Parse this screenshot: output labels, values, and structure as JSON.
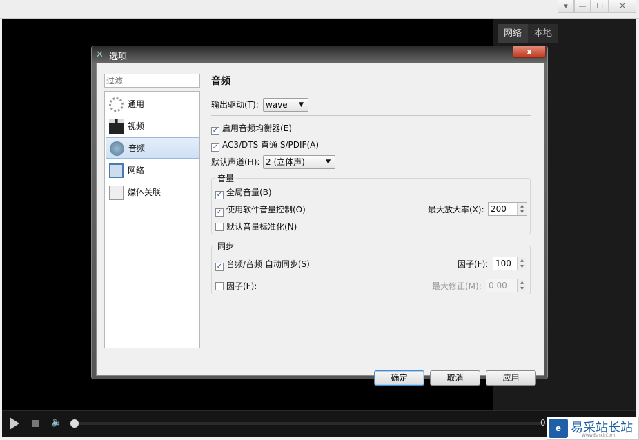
{
  "window": {
    "controls": [
      "▾",
      "—",
      "☐",
      "✕"
    ]
  },
  "right_panel": {
    "tabs": [
      "网络",
      "本地"
    ]
  },
  "player": {
    "time": "0"
  },
  "watermark": {
    "text": "易采站长站",
    "sub": "Www.EasckCom"
  },
  "dialog": {
    "title": "选项",
    "close": "x",
    "filter_placeholder": "过滤",
    "categories": [
      {
        "label": "通用",
        "icon": "gear-icon"
      },
      {
        "label": "视频",
        "icon": "clapperboard-icon"
      },
      {
        "label": "音频",
        "icon": "speaker-icon"
      },
      {
        "label": "网络",
        "icon": "network-icon"
      },
      {
        "label": "媒体关联",
        "icon": "file-association-icon"
      }
    ],
    "selected": "音频",
    "page_title": "音频",
    "output_driver_label": "输出驱动(T):",
    "output_driver_value": "wave",
    "enable_eq": {
      "label": "启用音频均衡器(E)",
      "checked": true
    },
    "passthrough": {
      "label": "AC3/DTS 直通 S/PDIF(A)",
      "checked": true
    },
    "channels_label": "默认声道(H):",
    "channels_value": "2 (立体声)",
    "volume_group": {
      "title": "音量",
      "global_volume": {
        "label": "全局音量(B)",
        "checked": true
      },
      "soft_volume": {
        "label": "使用软件音量控制(O)",
        "checked": true
      },
      "max_amp_label": "最大放大率(X):",
      "max_amp_value": "200",
      "normalize": {
        "label": "默认音量标准化(N)",
        "checked": false
      }
    },
    "sync_group": {
      "title": "同步",
      "autosync": {
        "label": "音频/音频 自动同步(S)",
        "checked": true
      },
      "factor_label": "因子(F):",
      "factor_value": "100",
      "factor2": {
        "label": "因子(F):",
        "checked": false
      },
      "max_correction_label": "最大修正(M):",
      "max_correction_value": "0.00"
    },
    "buttons": {
      "ok": "确定",
      "cancel": "取消",
      "apply": "应用"
    }
  }
}
